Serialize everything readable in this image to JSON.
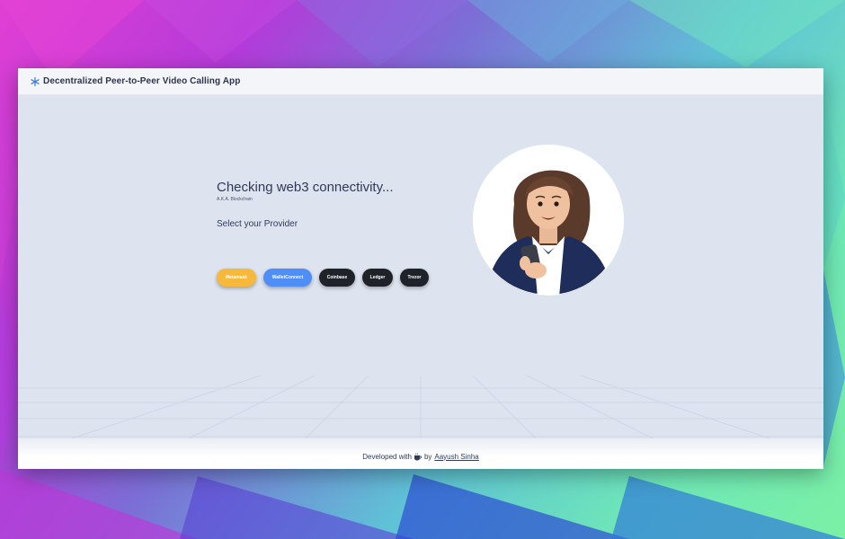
{
  "app": {
    "title": "Decentralized Peer-to-Peer Video Calling App",
    "icon": "snowflake-logo-icon"
  },
  "main": {
    "headline": "Checking web3 connectivity...",
    "subhead": "A.K.A. Blockchain",
    "provider_label": "Select your Provider",
    "providers": [
      {
        "label": "Metamask",
        "color": "#f6b93b"
      },
      {
        "label": "WalletConnect",
        "color": "#4f8ef7"
      },
      {
        "label": "Coinbase",
        "color": "#1f2329"
      },
      {
        "label": "Ledger",
        "color": "#1f2329"
      },
      {
        "label": "Trezor",
        "color": "#1f2329"
      }
    ],
    "illustration": "avatar-woman-with-phone"
  },
  "footer": {
    "prefix": "Developed with",
    "icon": "coffee-icon",
    "by": "by",
    "author": "Aayush Sinha"
  },
  "colors": {
    "page_bg": "#dde4ef",
    "navbar_bg": "#f3f5f9",
    "text": "#2f3a5a"
  }
}
